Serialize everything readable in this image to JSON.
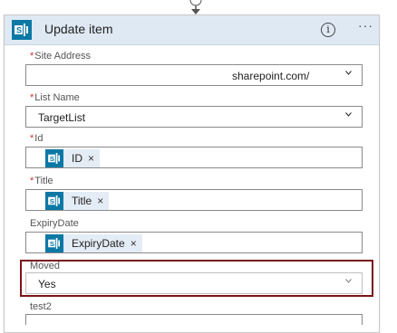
{
  "action": {
    "title": "Update item",
    "info_glyph": "i",
    "more_glyph": "···"
  },
  "fields": {
    "site_address": {
      "label": "Site Address",
      "required": "*",
      "value": "sharepoint.com/"
    },
    "list_name": {
      "label": "List Name",
      "required": "*",
      "value": "TargetList"
    },
    "id": {
      "label": "Id",
      "required": "*",
      "token": "ID",
      "remove": "×"
    },
    "title": {
      "label": "Title",
      "required": "*",
      "token": "Title",
      "remove": "×"
    },
    "expiry_date": {
      "label": "ExpiryDate",
      "token": "ExpiryDate",
      "remove": "×"
    },
    "moved": {
      "label": "Moved",
      "value": "Yes"
    },
    "test2": {
      "label": "test2"
    }
  },
  "colors": {
    "header_bg": "#dfe9f3",
    "sharepoint_brand": "#0b78a5",
    "token_bg": "#e4ecf5",
    "highlight_border": "#7b1416",
    "required_marker": "#cc3333"
  },
  "icons": {
    "action": "sharepoint-icon",
    "token": "sharepoint-icon",
    "dropdown": "chevron-down-icon",
    "info": "info-icon",
    "more": "more-options-icon",
    "connector": "down-arrow-icon"
  }
}
